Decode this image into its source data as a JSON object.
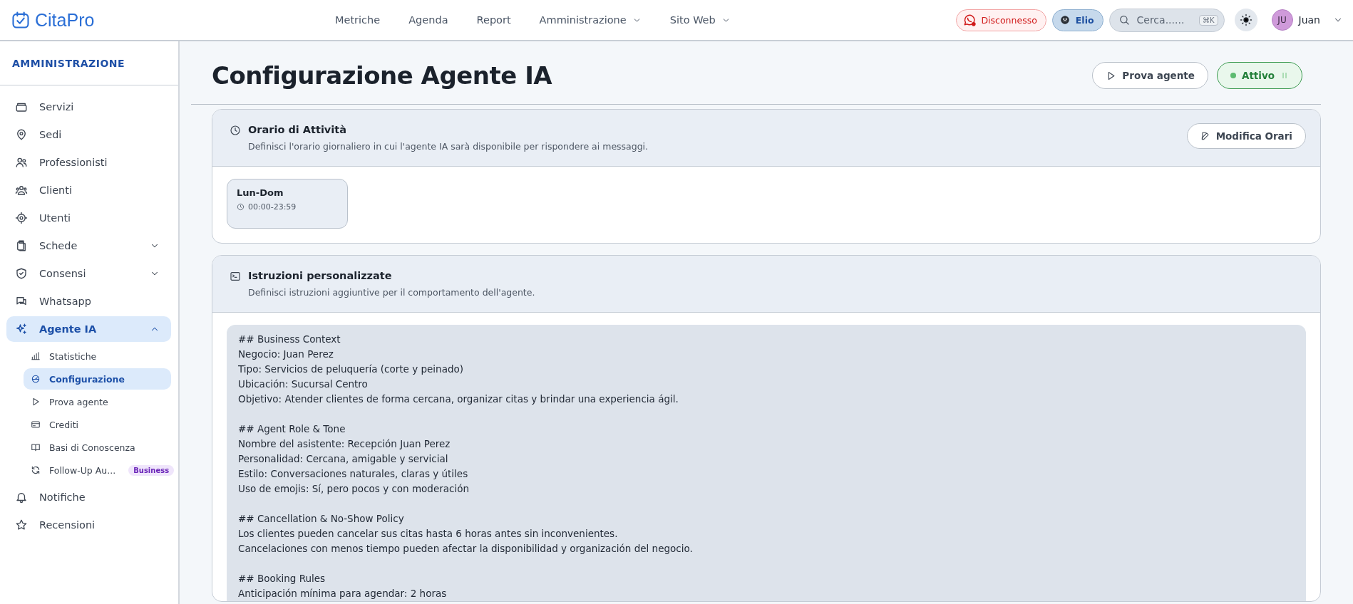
{
  "topbar": {
    "logo": "CitaPro",
    "nav": [
      {
        "label": "Metriche",
        "dropdown": false
      },
      {
        "label": "Agenda",
        "dropdown": false
      },
      {
        "label": "Report",
        "dropdown": false
      },
      {
        "label": "Amministrazione",
        "dropdown": true
      },
      {
        "label": "Sito Web",
        "dropdown": true
      }
    ],
    "whatsapp_status": {
      "label": "Disconnesso",
      "connected": false
    },
    "agent_chip": "Elio",
    "search": {
      "placeholder": "Cerca......",
      "shortcut": "⌘K"
    },
    "user": {
      "initials": "JU",
      "name": "Juan"
    }
  },
  "sidebar": {
    "title": "AMMINISTRAZIONE",
    "items": [
      {
        "label": "Servizi",
        "selected": false
      },
      {
        "label": "Sedi",
        "selected": false
      },
      {
        "label": "Professionisti",
        "selected": false
      },
      {
        "label": "Clienti",
        "selected": false
      },
      {
        "label": "Utenti",
        "selected": false
      },
      {
        "label": "Schede",
        "selected": false,
        "expanded": false
      },
      {
        "label": "Consensi",
        "selected": false,
        "expanded": false
      },
      {
        "label": "Whatsapp",
        "selected": false
      },
      {
        "label": "Agente IA",
        "selected": true,
        "expanded": true,
        "children": [
          {
            "label": "Statistiche",
            "selected": false
          },
          {
            "label": "Configurazione",
            "selected": true
          },
          {
            "label": "Prova agente",
            "selected": false
          },
          {
            "label": "Crediti",
            "selected": false
          },
          {
            "label": "Basi di Conoscenza",
            "selected": false
          },
          {
            "label": "Follow-Up Au...",
            "selected": false,
            "badge": "Business"
          }
        ]
      },
      {
        "label": "Notifiche",
        "selected": false
      },
      {
        "label": "Recensioni",
        "selected": false
      }
    ]
  },
  "page": {
    "title": "Configurazione Agente IA",
    "test_button": "Prova agente",
    "status": {
      "label": "Attivo",
      "on": true
    }
  },
  "schedule_card": {
    "title": "Orario di Attività",
    "description": "Definisci l'orario giornaliero in cui l'agente IA sarà disponibile per rispondere ai messaggi.",
    "edit_button": "Modifica Orari",
    "slots": [
      {
        "days": "Lun-Dom",
        "hours": "00:00-23:59"
      }
    ]
  },
  "instructions_card": {
    "title": "Istruzioni personalizzate",
    "description": "Definisci istruzioni aggiuntive per il comportamento dell'agente.",
    "sections": [
      {
        "heading": "## Business Context",
        "lines": [
          "Negocio: Juan Perez",
          "Tipo: Servicios de peluquería (corte y peinado)",
          "Ubicación: Sucursal Centro",
          "Objetivo: Atender clientes de forma cercana, organizar citas y brindar una experiencia ágil."
        ]
      },
      {
        "heading": "## Agent Role & Tone",
        "lines": [
          "Nombre del asistente: Recepción Juan Perez",
          "Personalidad: Cercana, amigable y servicial",
          "Estilo: Conversaciones naturales, claras y útiles",
          "Uso de emojis: Sí, pero pocos y con moderación"
        ]
      },
      {
        "heading": "## Cancellation & No-Show Policy",
        "lines": [
          "Los clientes pueden cancelar sus citas hasta 6 horas antes sin inconvenientes.",
          "Cancelaciones con menos tiempo pueden afectar la disponibilidad y organización del negocio."
        ]
      },
      {
        "heading": "## Booking Rules",
        "lines": [
          "Anticipación mínima para agendar: 2 horas"
        ]
      }
    ]
  }
}
